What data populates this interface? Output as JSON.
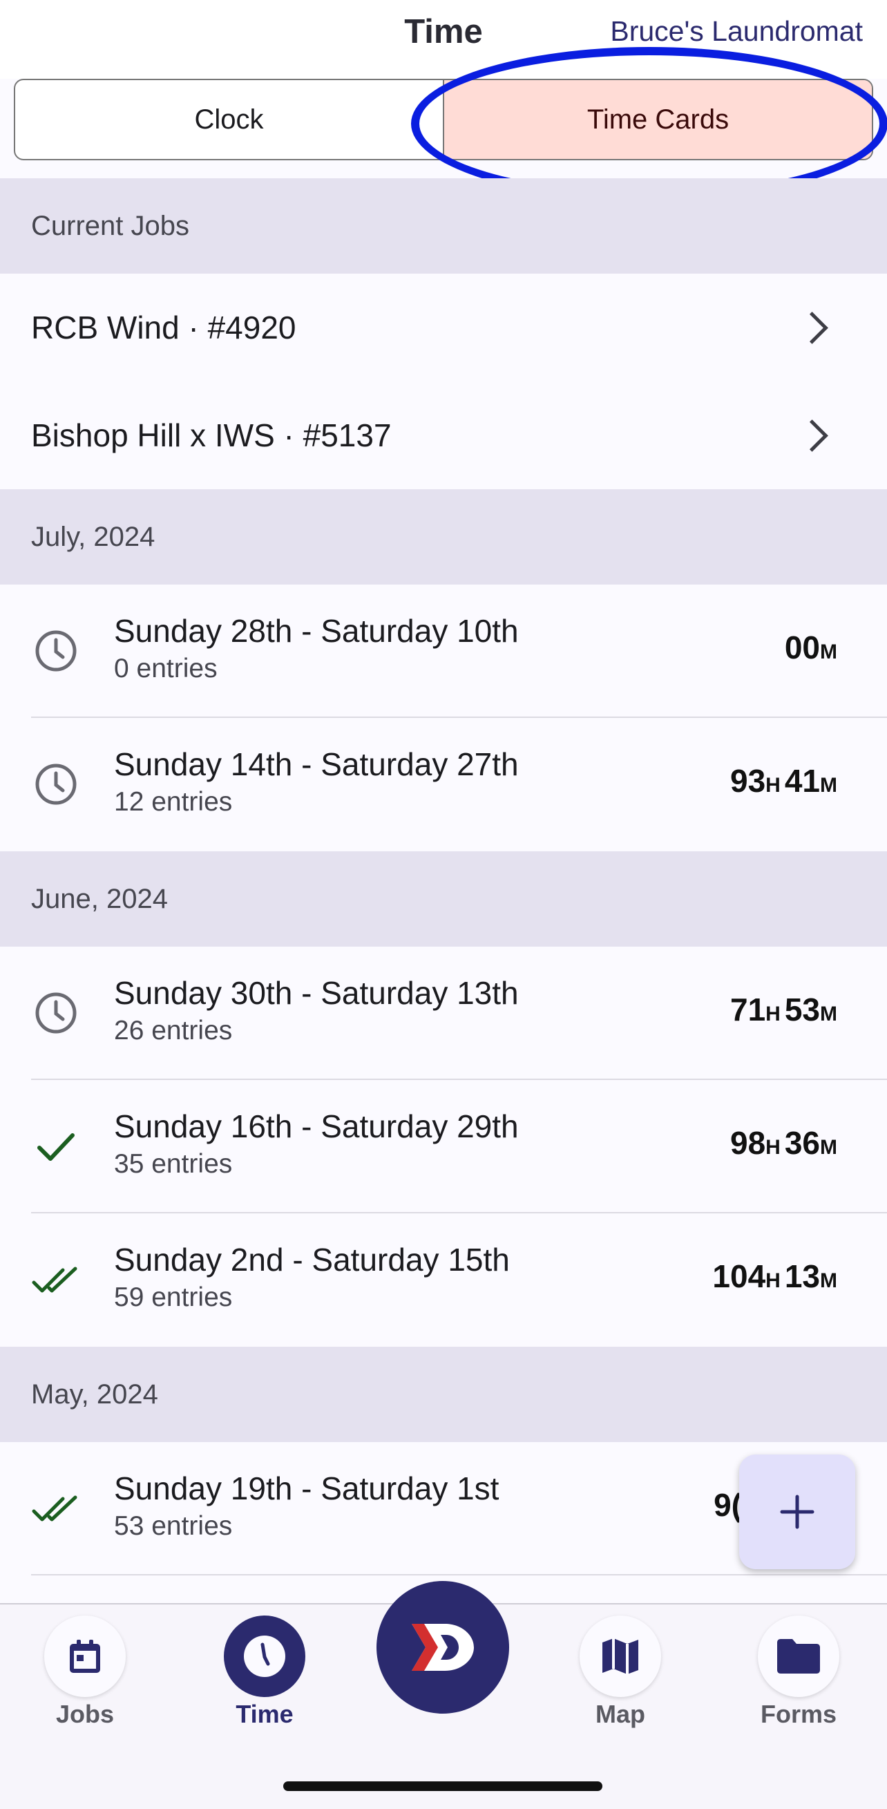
{
  "header": {
    "title": "Time",
    "org_name": "Bruce's Laundromat"
  },
  "segment": {
    "clock_label": "Clock",
    "time_cards_label": "Time Cards",
    "selected": "Time Cards"
  },
  "current_jobs": {
    "heading": "Current Jobs",
    "items": [
      {
        "label": "RCB Wind · #4920"
      },
      {
        "label": "Bishop Hill x IWS · #5137"
      }
    ]
  },
  "months": [
    {
      "heading": "July, 2024",
      "cards": [
        {
          "range": "Sunday 28th - Saturday 10th",
          "entries": "0 entries",
          "hours": "",
          "minutes": "00",
          "status_icon": "clock-icon"
        },
        {
          "range": "Sunday 14th - Saturday 27th",
          "entries": "12 entries",
          "hours": "93",
          "minutes": "41",
          "status_icon": "clock-icon"
        }
      ]
    },
    {
      "heading": "June, 2024",
      "cards": [
        {
          "range": "Sunday 30th - Saturday 13th",
          "entries": "26 entries",
          "hours": "71",
          "minutes": "53",
          "status_icon": "clock-icon"
        },
        {
          "range": "Sunday 16th - Saturday 29th",
          "entries": "35 entries",
          "hours": "98",
          "minutes": "36",
          "status_icon": "check-icon"
        },
        {
          "range": "Sunday 2nd - Saturday 15th",
          "entries": "59 entries",
          "hours": "104",
          "minutes": "13",
          "status_icon": "double-check-icon"
        }
      ]
    },
    {
      "heading": "May, 2024",
      "cards": [
        {
          "range": "Sunday 19th - Saturday 1st",
          "entries": "53 entries",
          "hours": "9(",
          "minutes": "",
          "status_icon": "double-check-icon"
        }
      ]
    }
  ],
  "units": {
    "hours": "H",
    "minutes": "M"
  },
  "fab": {
    "label": "+"
  },
  "nav": {
    "jobs": "Jobs",
    "time": "Time",
    "map": "Map",
    "forms": "Forms"
  },
  "colors": {
    "brand": "#2b2a6e",
    "selected_segment": "#ffdcd6",
    "section_header": "#e4e1ef",
    "check_green": "#1b5e20",
    "annotation_blue": "#0a1ee0"
  }
}
